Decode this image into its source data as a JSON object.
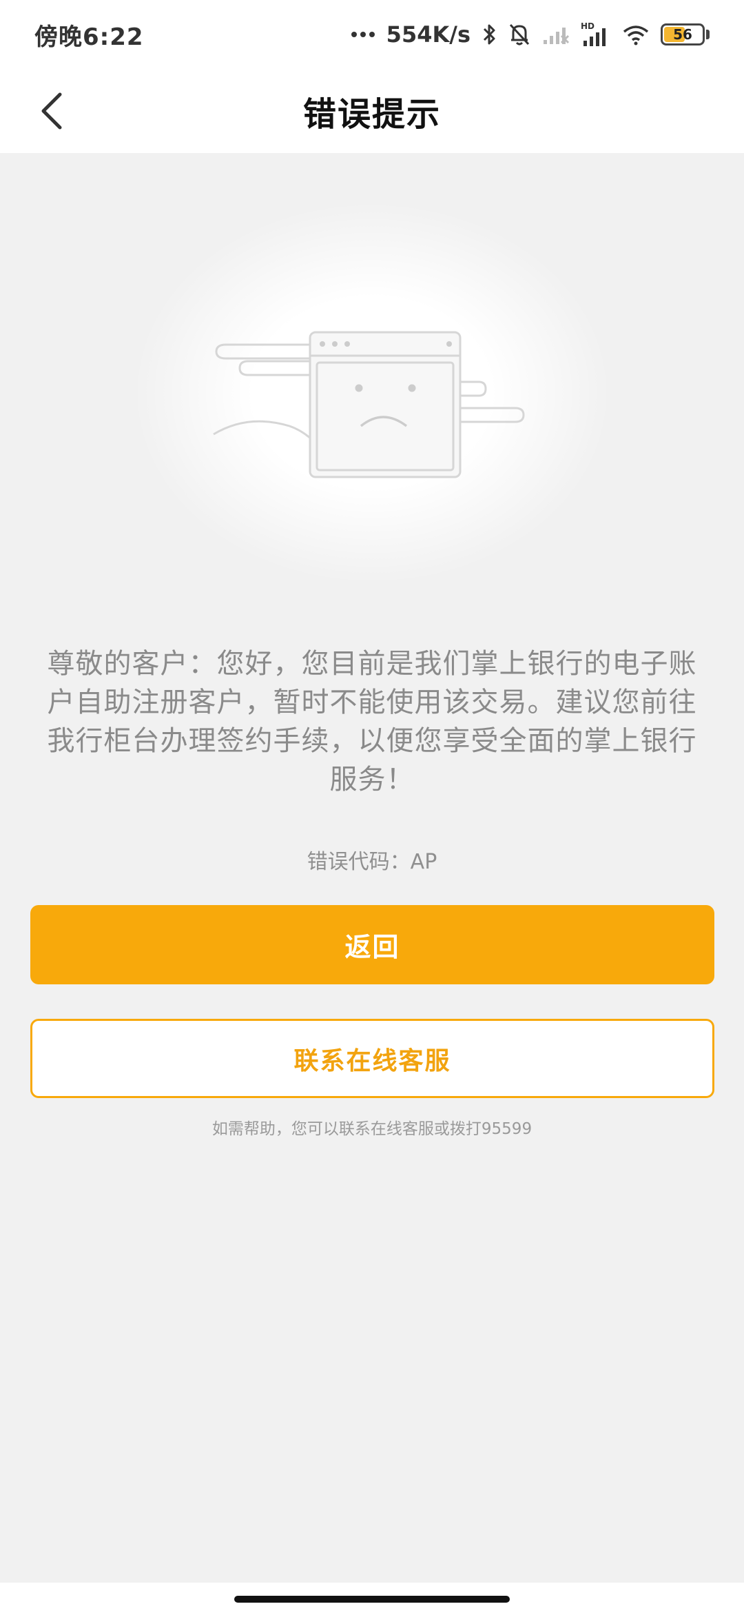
{
  "status_bar": {
    "time": "傍晚6:22",
    "network_speed": "554K/s",
    "battery": "56",
    "icons": [
      "more-dots-icon",
      "bluetooth-icon",
      "mute-bell-icon",
      "signal-weak-icon",
      "hd-signal-icon",
      "wifi-icon",
      "battery-icon"
    ],
    "hd_label": "HD"
  },
  "nav": {
    "title": "错误提示",
    "back_icon": "chevron-left-icon"
  },
  "illustration": {
    "icon": "sad-browser-window-icon"
  },
  "message": {
    "line1": "尊敬的客户：您好，您目前是我们掌上银行的电子账",
    "line2": "户自助注册客户，暂时不能使用该交易。建议您前往",
    "line3": "我行柜台办理签约手续，以便您享受全面的掌上银行",
    "line4": "服务！"
  },
  "error_code": "错误代码：AP",
  "buttons": {
    "back_label": "返回",
    "contact_label": "联系在线客服"
  },
  "help_text": "如需帮助，您可以联系在线客服或拨打95599",
  "colors": {
    "accent": "#f8a90b",
    "background": "#f1f1f1",
    "text_muted": "#8a8a8a"
  }
}
